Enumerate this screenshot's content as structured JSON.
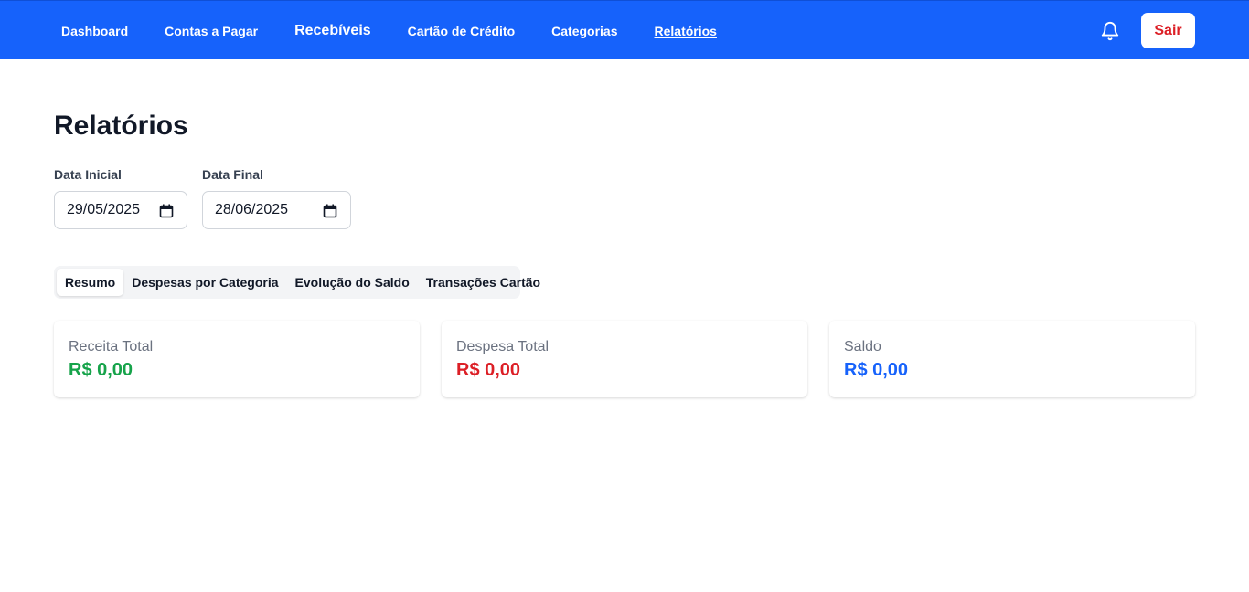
{
  "nav": {
    "links": [
      {
        "label": "Dashboard"
      },
      {
        "label": "Contas a Pagar"
      },
      {
        "label": "Recebíveis"
      },
      {
        "label": "Cartão de Crédito"
      },
      {
        "label": "Categorias"
      },
      {
        "label": "Relatórios"
      }
    ],
    "active": "Relatórios",
    "notification_icon": "bell-icon",
    "logout_label": "Sair",
    "colors": {
      "background": "#1662fb",
      "logout_text": "#dc1f26"
    }
  },
  "page": {
    "title": "Relatórios"
  },
  "filters": {
    "start_label": "Data Inicial",
    "start_value": "29/05/2025",
    "end_label": "Data Final",
    "end_value": "28/06/2025",
    "calendar_icon": "calendar-icon"
  },
  "tabs": {
    "items": [
      {
        "label": "Resumo"
      },
      {
        "label": "Despesas por Categoria"
      },
      {
        "label": "Evolução do Saldo"
      },
      {
        "label": "Transações Cartão"
      }
    ],
    "active": "Resumo"
  },
  "summary": {
    "cards": [
      {
        "label": "Receita Total",
        "value": "R$ 0,00",
        "color": "#16a34a"
      },
      {
        "label": "Despesa Total",
        "value": "R$ 0,00",
        "color": "#dc1f26"
      },
      {
        "label": "Saldo",
        "value": "R$ 0,00",
        "color": "#1662fb"
      }
    ]
  }
}
